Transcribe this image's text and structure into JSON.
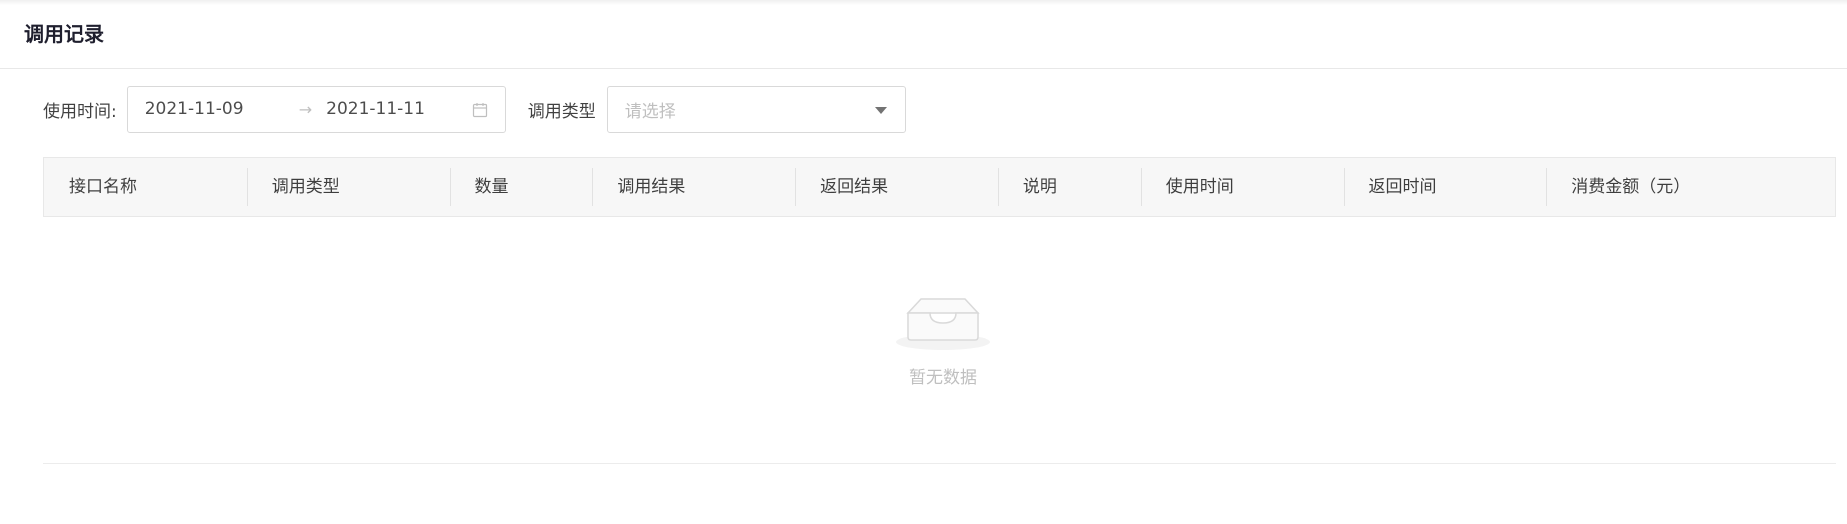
{
  "header": {
    "title": "调用记录"
  },
  "filters": {
    "time_label": "使用时间:",
    "start_date": "2021-11-09",
    "end_date": "2021-11-11",
    "separator": "→",
    "type_label": "调用类型",
    "type_placeholder": "请选择"
  },
  "table": {
    "columns": [
      {
        "label": "接口名称"
      },
      {
        "label": "调用类型"
      },
      {
        "label": "数量"
      },
      {
        "label": "调用结果"
      },
      {
        "label": "返回结果"
      },
      {
        "label": "说明"
      },
      {
        "label": "使用时间"
      },
      {
        "label": "返回时间"
      },
      {
        "label": "消费金额（元）"
      }
    ],
    "empty_text": "暂无数据"
  },
  "icons": {
    "calendar": "calendar-icon",
    "caret": "caret-down-icon",
    "empty": "empty-box-icon"
  }
}
